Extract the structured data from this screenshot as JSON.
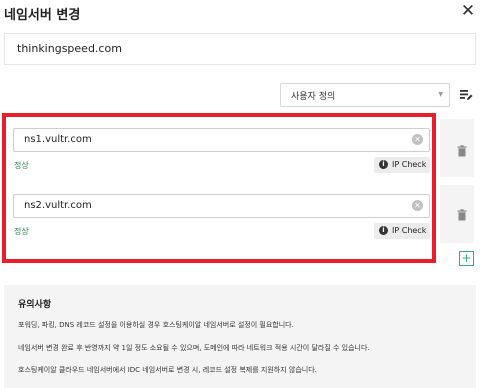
{
  "dialog": {
    "title": "네임서버 변경"
  },
  "domain": {
    "value": "thinkingspeed.com"
  },
  "mode_select": {
    "selected": "사용자 정의"
  },
  "nameservers": [
    {
      "value": "ns1.vultr.com",
      "status": "정상",
      "ip_check_label": "IP Check"
    },
    {
      "value": "ns2.vultr.com",
      "status": "정상",
      "ip_check_label": "IP Check"
    }
  ],
  "notice": {
    "heading": "유의사항",
    "lines": [
      "포워딩, 파킹, DNS 레코드 설정을 이용하실 경우 호스팅케이알 네임서버로 설정이 필요합니다.",
      "네임서버 변경 완료 후 반영까지 약 1일 정도 소요될 수 있으며, 도메인에 따라 네트워크 적용 시간이 달라질 수 있습니다.",
      "호스팅케이알 클라우드 네임서버에서 IDC 네임서버로 변경 시, 레코드 설정 복제를 지원하지 않습니다."
    ]
  },
  "colors": {
    "highlight": "#e81f2a",
    "status_ok": "#2e8b57",
    "add_button": "#3aa77c"
  },
  "icons": [
    "close-icon",
    "edit-icon",
    "clear-icon",
    "info-icon",
    "trash-icon",
    "plus-icon"
  ]
}
